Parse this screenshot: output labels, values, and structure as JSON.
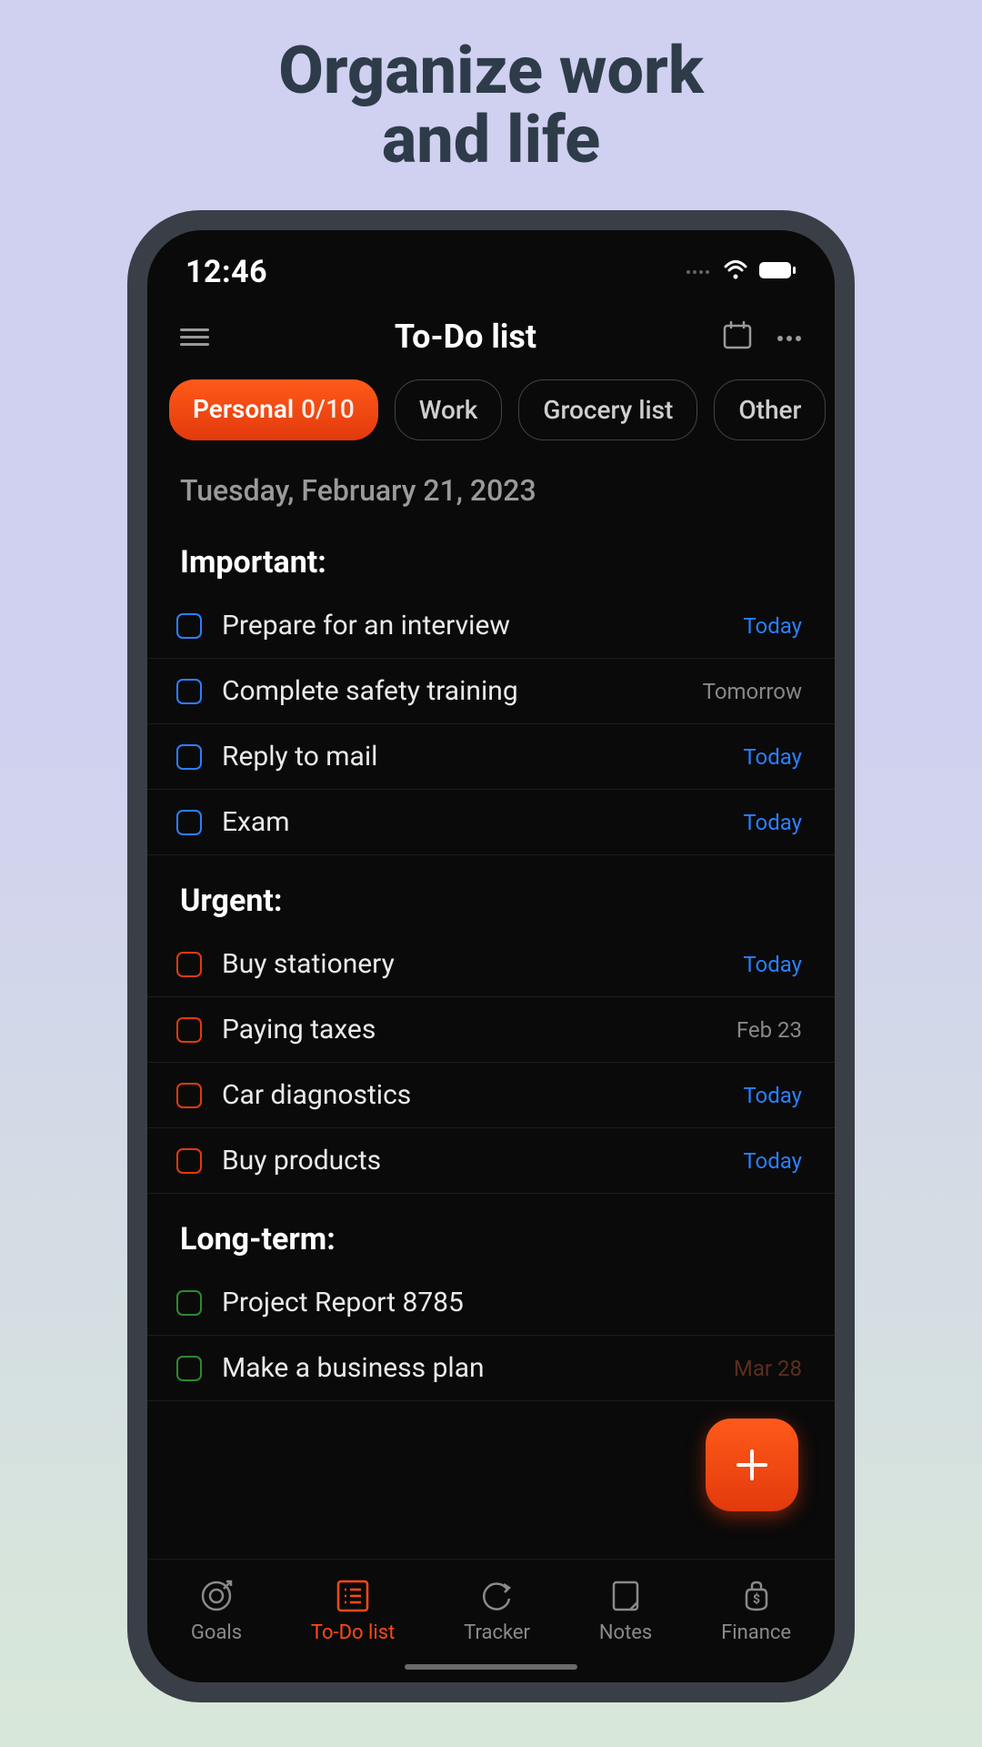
{
  "hero": {
    "line1": "Organize work",
    "line2": "and life"
  },
  "status": {
    "time": "12:46"
  },
  "header": {
    "title": "To-Do list"
  },
  "tabs": [
    {
      "label": "Personal",
      "count": "0/10",
      "active": true
    },
    {
      "label": "Work",
      "active": false
    },
    {
      "label": "Grocery list",
      "active": false
    },
    {
      "label": "Other",
      "active": false
    }
  ],
  "date": "Tuesday, February 21, 2023",
  "sections": [
    {
      "title": "Important:",
      "checkbox_color": "important",
      "items": [
        {
          "label": "Prepare for an interview",
          "due": "Today",
          "due_style": "today"
        },
        {
          "label": "Complete safety training",
          "due": "Tomorrow",
          "due_style": "grey"
        },
        {
          "label": "Reply to mail",
          "due": "Today",
          "due_style": "today"
        },
        {
          "label": "Exam",
          "due": "Today",
          "due_style": "today"
        }
      ]
    },
    {
      "title": "Urgent:",
      "checkbox_color": "urgent",
      "items": [
        {
          "label": "Buy stationery",
          "due": "Today",
          "due_style": "today"
        },
        {
          "label": "Paying taxes",
          "due": "Feb 23",
          "due_style": "grey"
        },
        {
          "label": "Car diagnostics",
          "due": "Today",
          "due_style": "today"
        },
        {
          "label": "Buy products",
          "due": "Today",
          "due_style": "today"
        }
      ]
    },
    {
      "title": "Long-term:",
      "checkbox_color": "long",
      "items": [
        {
          "label": "Project Report 8785",
          "due": "",
          "due_style": ""
        },
        {
          "label": "Make a business plan",
          "due": "Mar 28",
          "due_style": "faded"
        }
      ]
    }
  ],
  "nav": [
    {
      "label": "Goals",
      "icon": "target"
    },
    {
      "label": "To-Do list",
      "icon": "list",
      "active": true
    },
    {
      "label": "Tracker",
      "icon": "refresh"
    },
    {
      "label": "Notes",
      "icon": "note"
    },
    {
      "label": "Finance",
      "icon": "money"
    }
  ]
}
